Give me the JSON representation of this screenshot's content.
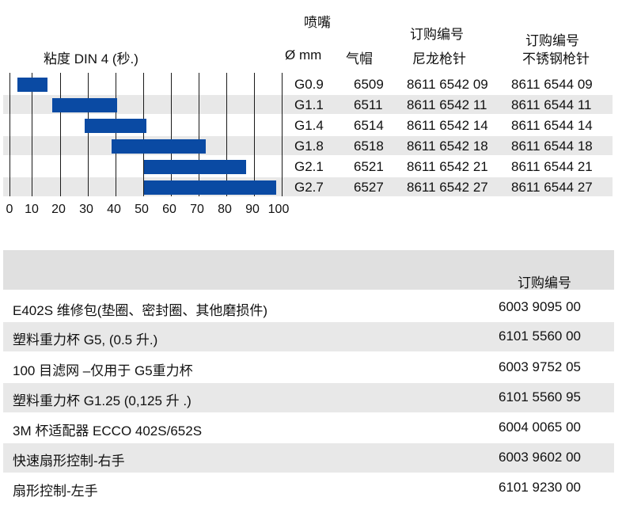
{
  "header": {
    "viscosity_label": "粘度 DIN 4 (秒.)",
    "nozzle_label": "喷嘴",
    "diameter_label": "Ø mm",
    "aircap_label": "气帽",
    "order_no_label_1": "订购编号",
    "nylon_gun_label": "尼龙枪针",
    "order_no_label_2": "订购编号",
    "stainless_gun_label": "不锈钢枪针"
  },
  "axis_ticks": [
    "0",
    "10",
    "20",
    "30",
    "40",
    "50",
    "60",
    "70",
    "80",
    "90",
    "100"
  ],
  "chart_data": {
    "type": "bar",
    "xlabel": "粘度 DIN 4 (秒.)",
    "xlim": [
      0,
      100
    ],
    "categories": [
      "G0.9",
      "G1.1",
      "G1.4",
      "G1.8",
      "G2.1",
      "G2.7"
    ],
    "ranges": [
      [
        3,
        14
      ],
      [
        16,
        40
      ],
      [
        28,
        51
      ],
      [
        38,
        73
      ],
      [
        50,
        88
      ],
      [
        50,
        99
      ]
    ]
  },
  "nozzles": [
    {
      "size": "G0.9",
      "aircap": "6509",
      "nylon": "8611 6542 09",
      "stainless": "8611 6544 09"
    },
    {
      "size": "G1.1",
      "aircap": "6511",
      "nylon": "8611 6542 11",
      "stainless": "8611 6544 11"
    },
    {
      "size": "G1.4",
      "aircap": "6514",
      "nylon": "8611 6542 14",
      "stainless": "8611 6544 14"
    },
    {
      "size": "G1.8",
      "aircap": "6518",
      "nylon": "8611 6542 18",
      "stainless": "8611 6544 18"
    },
    {
      "size": "G2.1",
      "aircap": "6521",
      "nylon": "8611 6542 21",
      "stainless": "8611 6544 21"
    },
    {
      "size": "G2.7",
      "aircap": "6527",
      "nylon": "8611 6542 27",
      "stainless": "8611 6544 27"
    }
  ],
  "accessories": {
    "order_no_label": "订购编号",
    "items": [
      {
        "name": "E402S 维修包(垫圈、密封圈、其他磨损件)",
        "code": "6003 9095 00"
      },
      {
        "name": "塑料重力杯 G5, (0.5 升.)",
        "code": "6101 5560 00"
      },
      {
        "name": " 100 目滤网 –仅用于 G5重力杯",
        "code": "6003 9752 05"
      },
      {
        "name": "塑料重力杯 G1.25 (0,125 升 .)",
        "code": "6101 5560 95"
      },
      {
        "name": "3M 杯适配器 ECCO 402S/652S",
        "code": "6004 0065 00"
      },
      {
        "name": "快速扇形控制-右手",
        "code": "6003 9602 00"
      },
      {
        "name": "扇形控制-左手",
        "code": "6101 9230 00"
      }
    ]
  },
  "colors": {
    "bar": "#0a4aa3",
    "stripe": "#e8e8e8",
    "header_band": "#e0e0e0"
  }
}
